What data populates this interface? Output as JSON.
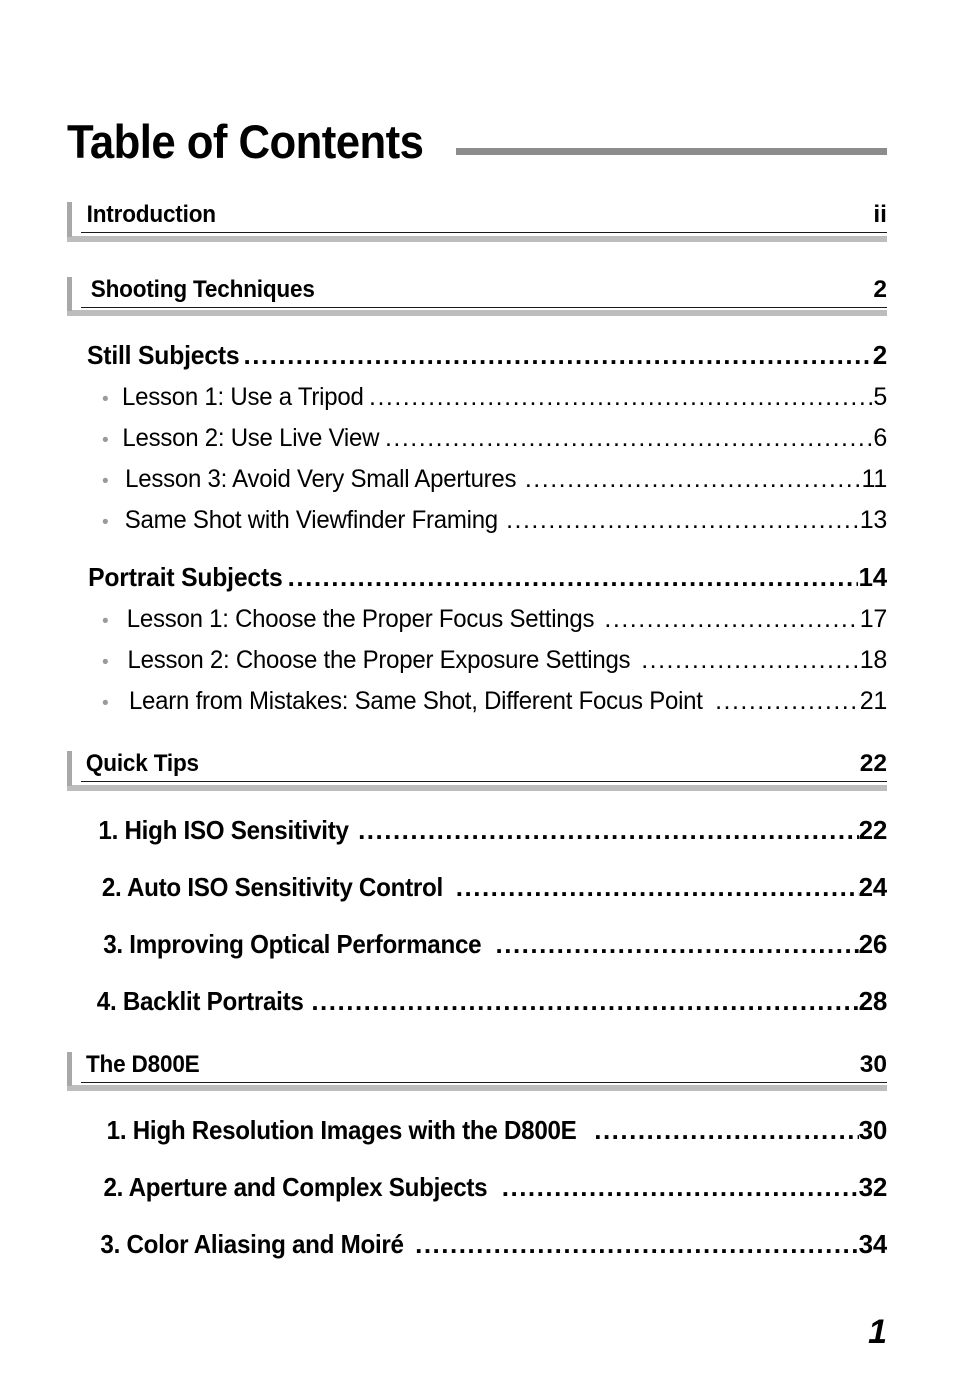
{
  "document": {
    "title": "Table of Contents",
    "folio": "1",
    "leader_char": ".",
    "bullet_char": "•",
    "colors": {
      "title_rule": "#8c8c8c",
      "section_bar": "#a8a8a8",
      "section_shadow": "#bdbdbd",
      "rule_dark": "#1a1a1a",
      "bullet": "#9a9a9a",
      "text": "#000000",
      "background": "#ffffff"
    }
  },
  "sections": [
    {
      "kind": "header",
      "title": "Introduction",
      "page": "ii",
      "entries": []
    },
    {
      "kind": "header",
      "title": "Shooting Techniques",
      "page": "2",
      "entries": [
        {
          "level": 2,
          "text": "Still Subjects",
          "page": "2"
        },
        {
          "level": 3,
          "text": "Lesson 1: Use a Tripod",
          "page": "5"
        },
        {
          "level": 3,
          "text": "Lesson 2: Use Live View",
          "page": "6"
        },
        {
          "level": 3,
          "text": "Lesson 3: Avoid Very Small Apertures",
          "page": "11"
        },
        {
          "level": 3,
          "text": "Same Shot with Viewfinder Framing",
          "page": "13"
        },
        {
          "level": 2,
          "text": "Portrait Subjects",
          "page": "14"
        },
        {
          "level": 3,
          "text": "Lesson 1: Choose the Proper Focus Settings",
          "page": "17"
        },
        {
          "level": 3,
          "text": "Lesson 2: Choose the Proper Exposure Settings",
          "page": "18"
        },
        {
          "level": 3,
          "text": "Learn from Mistakes: Same Shot, Different Focus Point",
          "page": "21"
        }
      ]
    },
    {
      "kind": "header",
      "title": "Quick Tips",
      "page": "22",
      "entries": [
        {
          "level": "num",
          "text": "1. High ISO Sensitivity",
          "page": "22"
        },
        {
          "level": "num",
          "text": "2. Auto ISO Sensitivity Control",
          "page": "24"
        },
        {
          "level": "num",
          "text": "3. Improving Optical Performance",
          "page": "26"
        },
        {
          "level": "num",
          "text": "4. Backlit Portraits",
          "page": "28"
        }
      ]
    },
    {
      "kind": "header",
      "title": "The D800E",
      "page": "30",
      "entries": [
        {
          "level": "num",
          "text": "1. High Resolution Images with the D800E",
          "page": "30"
        },
        {
          "level": "num",
          "text": "2. Aperture and Complex Subjects",
          "page": "32"
        },
        {
          "level": "num",
          "text": "3. Color Aliasing and Moiré",
          "page": "34"
        }
      ]
    }
  ]
}
